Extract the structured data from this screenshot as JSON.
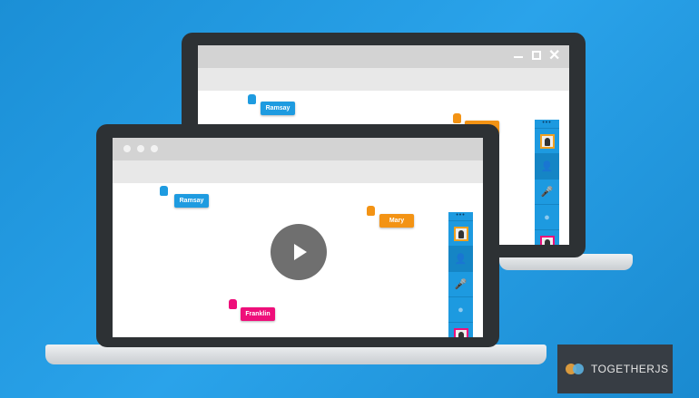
{
  "back_window": {
    "controls": [
      "minimize-icon",
      "maximize-icon",
      "close-icon"
    ],
    "cursors": [
      {
        "name": "Ramsay",
        "color": "#1e9be0"
      },
      {
        "name": "",
        "color": "#f39314"
      }
    ]
  },
  "front_window": {
    "cursors": [
      {
        "name": "Ramsay",
        "color": "#1e9be0"
      },
      {
        "name": "Mary",
        "color": "#f39314"
      },
      {
        "name": "Franklin",
        "color": "#ee0f7a"
      }
    ],
    "play_icon": "play-icon"
  },
  "panel_icons": [
    "avatar",
    "add-user-icon",
    "microphone-icon",
    "chat-icon",
    "avatar"
  ],
  "logo": {
    "text": "TOGETHERJS"
  },
  "colors": {
    "background": "#1e96dc",
    "bezel": "#2d3134",
    "panel": "#1d9ae0",
    "logo_bg": "#373d44"
  }
}
